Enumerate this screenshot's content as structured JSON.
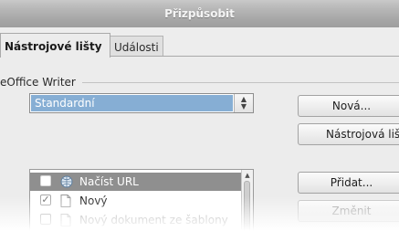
{
  "window": {
    "title": "Přizpůsobit"
  },
  "tabs": [
    {
      "label": "Nástrojové lišty",
      "active": true
    },
    {
      "label": "Události",
      "active": false
    }
  ],
  "group": {
    "label": "eOffice Writer"
  },
  "toolbar_select": {
    "value": "Standardní"
  },
  "buttons": {
    "new": "Nová...",
    "toolbar": "Nástrojová liš",
    "add": "Přidat...",
    "change": "Změnit"
  },
  "commands": [
    {
      "label": "Načíst URL",
      "checked": false,
      "selected": true,
      "icon": "globe-icon"
    },
    {
      "label": "Nový",
      "checked": true,
      "selected": false,
      "icon": "document-icon"
    },
    {
      "label": "Nový dokument ze šablony",
      "checked": false,
      "selected": false,
      "disabled": true,
      "icon": "document-icon"
    }
  ],
  "colors": {
    "selection": "#86aed4",
    "list_selection": "#8f8f8f",
    "titlebar": "#a7a7a7"
  }
}
